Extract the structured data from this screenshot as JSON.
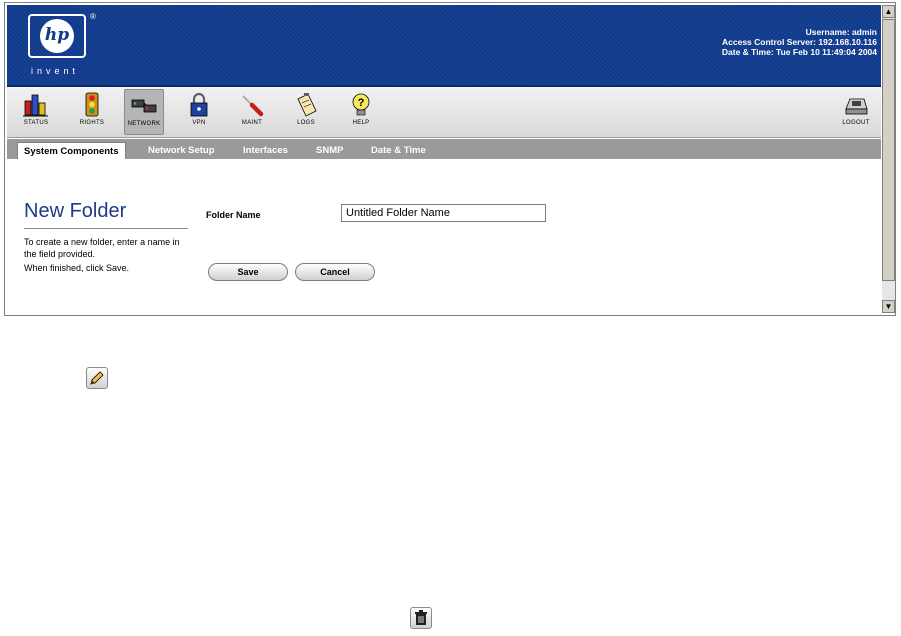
{
  "header": {
    "logo_text": "hp",
    "logo_reg": "®",
    "tagline": "invent",
    "username_line": "Username: admin",
    "server_line": "Access Control Server: 192.168.10.116",
    "datetime_line": "Date & Time: Tue Feb 10 11:49:04 2004"
  },
  "toolbar": {
    "items": [
      {
        "label": "STATUS",
        "icon": "status-chart-icon"
      },
      {
        "label": "RIGHTS",
        "icon": "traffic-light-icon"
      },
      {
        "label": "NETWORK",
        "icon": "network-icon"
      },
      {
        "label": "VPN",
        "icon": "padlock-icon"
      },
      {
        "label": "MAINT",
        "icon": "screwdriver-icon"
      },
      {
        "label": "LOGS",
        "icon": "clipboard-icon"
      },
      {
        "label": "HELP",
        "icon": "help-bulb-icon"
      }
    ],
    "logout_label": "LOGOUT"
  },
  "tabs": [
    "System Components",
    "Network Setup",
    "Interfaces",
    "SNMP",
    "Date & Time"
  ],
  "page": {
    "title": "New Folder",
    "desc_line1": "To create a new folder, enter a name in the field provided.",
    "desc_line2": "When finished, click Save.",
    "folder_label": "Folder Name",
    "folder_value": "Untitled Folder Name",
    "save_label": "Save",
    "cancel_label": "Cancel"
  },
  "colors": {
    "header_blue": "#103a8c",
    "title_blue": "#1f3a8a",
    "tab_bar_gray": "#9a9a9a"
  },
  "icons": {
    "edit": "pencil-icon",
    "delete": "trash-icon"
  }
}
